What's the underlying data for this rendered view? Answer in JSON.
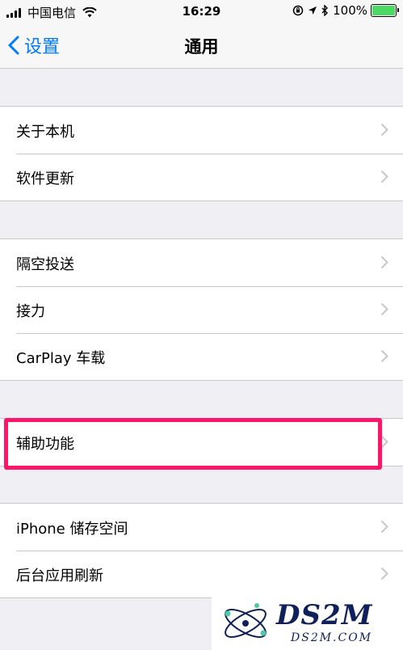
{
  "status_bar": {
    "carrier": "中国电信",
    "time": "16:29",
    "battery": "100%",
    "icons": [
      "signal-icon",
      "wifi-icon",
      "orientation-lock-icon",
      "location-icon",
      "bluetooth-icon",
      "battery-icon"
    ]
  },
  "nav": {
    "back_label": "设置",
    "title": "通用"
  },
  "groups": [
    {
      "items": [
        {
          "label": "关于本机"
        },
        {
          "label": "软件更新"
        }
      ]
    },
    {
      "items": [
        {
          "label": "隔空投送"
        },
        {
          "label": "接力"
        },
        {
          "label": "CarPlay 车载"
        }
      ]
    },
    {
      "items": [
        {
          "label": "辅助功能"
        }
      ]
    },
    {
      "items": [
        {
          "label": "iPhone 储存空间"
        },
        {
          "label": "后台应用刷新"
        }
      ]
    }
  ],
  "watermark": {
    "logo": "DS2M",
    "url": "DS2M.COM"
  },
  "colors": {
    "accent": "#007aff",
    "highlight": "#ff1569",
    "background": "#efeff4",
    "battery": "#4cd964"
  }
}
